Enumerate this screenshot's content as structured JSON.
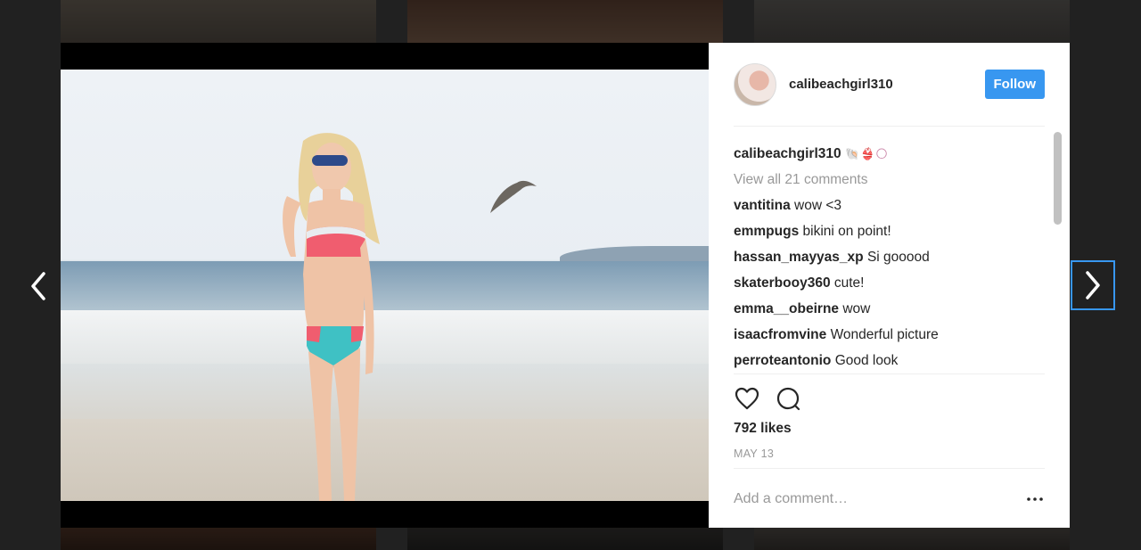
{
  "post": {
    "username": "calibeachgirl310",
    "follow_label": "Follow",
    "caption_user": "calibeachgirl310",
    "caption_text": "🐚👙🌕",
    "view_all_comments": "View all 21 comments",
    "comments": [
      {
        "user": "vantitina",
        "text": "wow <3"
      },
      {
        "user": "emmpugs",
        "text": "bikini on point!"
      },
      {
        "user": "hassan_mayyas_xp",
        "text": "Si gooood"
      },
      {
        "user": "skaterbooy360",
        "text": "cute!"
      },
      {
        "user": "emma__obeirne",
        "text": "wow"
      },
      {
        "user": "isaacfromvine",
        "text": "Wonderful picture"
      },
      {
        "user": "perroteantonio",
        "text": "Good look"
      }
    ],
    "likes": "792 likes",
    "date": "MAY 13",
    "add_comment_placeholder": "Add a comment…",
    "more_label": "•••"
  },
  "icons": {
    "prev": "chevron-left-icon",
    "next": "chevron-right-icon",
    "like": "heart-icon",
    "comment": "comment-bubble-icon",
    "more": "more-dots-icon"
  },
  "colors": {
    "accent": "#3897f0",
    "text": "#262626",
    "muted": "#999999"
  }
}
